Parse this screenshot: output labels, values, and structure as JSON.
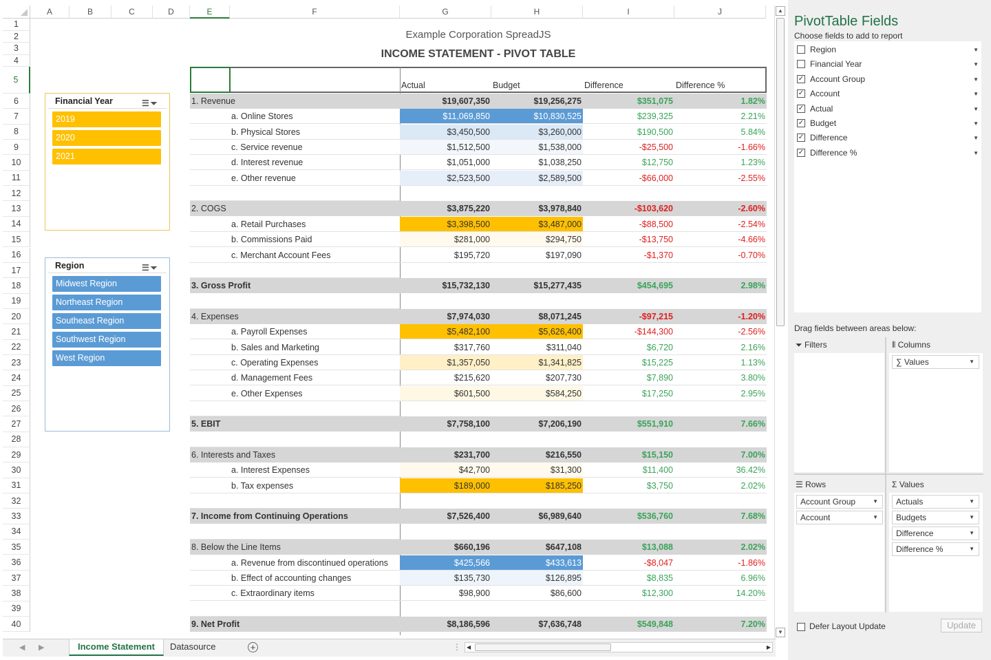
{
  "columns": [
    "A",
    "B",
    "C",
    "D",
    "E",
    "F",
    "G",
    "H",
    "I",
    "J"
  ],
  "rows": [
    "1",
    "2",
    "3",
    "4",
    "5",
    "6",
    "7",
    "8",
    "9",
    "10",
    "11",
    "12",
    "13",
    "14",
    "15",
    "16",
    "17",
    "18",
    "19",
    "20",
    "21",
    "22",
    "23",
    "24",
    "25",
    "26",
    "27",
    "28",
    "29",
    "30",
    "31",
    "32",
    "33",
    "34",
    "35",
    "36",
    "37",
    "38",
    "39",
    "40"
  ],
  "company": "Example Corporation SpreadJS",
  "report_title": "INCOME STATEMENT - PIVOT TABLE",
  "headers": {
    "actual": "Actual",
    "budget": "Budget",
    "difference": "Difference",
    "difference_pct": "Difference %"
  },
  "pivot_rows": [
    {
      "type": "grp",
      "label": "1. Revenue",
      "actual": "$19,607,350",
      "budget": "$19,256,275",
      "diff": "$351,075",
      "pct": "1.82%",
      "sign": "pos"
    },
    {
      "type": "sub",
      "label": "a. Online Stores",
      "actual": "$11,069,850",
      "budget": "$10,830,525",
      "diff": "$239,325",
      "pct": "2.21%",
      "sign": "pos",
      "fill": "#5b9bd5"
    },
    {
      "type": "sub",
      "label": "b. Physical Stores",
      "actual": "$3,450,500",
      "budget": "$3,260,000",
      "diff": "$190,500",
      "pct": "5.84%",
      "sign": "pos",
      "fill": "#dbe8f6"
    },
    {
      "type": "sub",
      "label": "c. Service revenue",
      "actual": "$1,512,500",
      "budget": "$1,538,000",
      "diff": "-$25,500",
      "pct": "-1.66%",
      "sign": "neg",
      "fill": "#f3f7fc"
    },
    {
      "type": "sub",
      "label": "d. Interest revenue",
      "actual": "$1,051,000",
      "budget": "$1,038,250",
      "diff": "$12,750",
      "pct": "1.23%",
      "sign": "pos"
    },
    {
      "type": "sub",
      "label": "e. Other revenue",
      "actual": "$2,523,500",
      "budget": "$2,589,500",
      "diff": "-$66,000",
      "pct": "-2.55%",
      "sign": "neg",
      "fill": "#e6eff9"
    },
    {
      "type": "blank"
    },
    {
      "type": "grp",
      "label": "2. COGS",
      "actual": "$3,875,220",
      "budget": "$3,978,840",
      "diff": "-$103,620",
      "pct": "-2.60%",
      "sign": "neg"
    },
    {
      "type": "sub",
      "label": "a. Retail Purchases",
      "actual": "$3,398,500",
      "budget": "$3,487,000",
      "diff": "-$88,500",
      "pct": "-2.54%",
      "sign": "neg",
      "fill": "#ffc000"
    },
    {
      "type": "sub",
      "label": "b. Commissions Paid",
      "actual": "$281,000",
      "budget": "$294,750",
      "diff": "-$13,750",
      "pct": "-4.66%",
      "sign": "neg",
      "fill": "#fffaed"
    },
    {
      "type": "sub",
      "label": "c. Merchant Account Fees",
      "actual": "$195,720",
      "budget": "$197,090",
      "diff": "-$1,370",
      "pct": "-0.70%",
      "sign": "neg"
    },
    {
      "type": "blank"
    },
    {
      "type": "tot",
      "label": "3. Gross Profit",
      "actual": "$15,732,130",
      "budget": "$15,277,435",
      "diff": "$454,695",
      "pct": "2.98%",
      "sign": "pos"
    },
    {
      "type": "blank"
    },
    {
      "type": "grp",
      "label": "4. Expenses",
      "actual": "$7,974,030",
      "budget": "$8,071,245",
      "diff": "-$97,215",
      "pct": "-1.20%",
      "sign": "neg"
    },
    {
      "type": "sub",
      "label": "a. Payroll Expenses",
      "actual": "$5,482,100",
      "budget": "$5,626,400",
      "diff": "-$144,300",
      "pct": "-2.56%",
      "sign": "neg",
      "fill": "#ffc000"
    },
    {
      "type": "sub",
      "label": "b. Sales and Marketing",
      "actual": "$317,760",
      "budget": "$311,040",
      "diff": "$6,720",
      "pct": "2.16%",
      "sign": "pos"
    },
    {
      "type": "sub",
      "label": "c. Operating Expenses",
      "actual": "$1,357,050",
      "budget": "$1,341,825",
      "diff": "$15,225",
      "pct": "1.13%",
      "sign": "pos",
      "fill": "#fff0c8"
    },
    {
      "type": "sub",
      "label": "d. Management Fees",
      "actual": "$215,620",
      "budget": "$207,730",
      "diff": "$7,890",
      "pct": "3.80%",
      "sign": "pos"
    },
    {
      "type": "sub",
      "label": "e. Other Expenses",
      "actual": "$601,500",
      "budget": "$584,250",
      "diff": "$17,250",
      "pct": "2.95%",
      "sign": "pos",
      "fill": "#fff8e5"
    },
    {
      "type": "blank"
    },
    {
      "type": "tot",
      "label": "5. EBIT",
      "actual": "$7,758,100",
      "budget": "$7,206,190",
      "diff": "$551,910",
      "pct": "7.66%",
      "sign": "pos"
    },
    {
      "type": "blank"
    },
    {
      "type": "grp",
      "label": "6. Interests and Taxes",
      "actual": "$231,700",
      "budget": "$216,550",
      "diff": "$15,150",
      "pct": "7.00%",
      "sign": "pos"
    },
    {
      "type": "sub",
      "label": "a. Interest Expenses",
      "actual": "$42,700",
      "budget": "$31,300",
      "diff": "$11,400",
      "pct": "36.42%",
      "sign": "pos",
      "fill": "#fffaed"
    },
    {
      "type": "sub",
      "label": "b. Tax expenses",
      "actual": "$189,000",
      "budget": "$185,250",
      "diff": "$3,750",
      "pct": "2.02%",
      "sign": "pos",
      "fill": "#ffc000"
    },
    {
      "type": "blank"
    },
    {
      "type": "tot",
      "label": "7. Income from Continuing Operations",
      "actual": "$7,526,400",
      "budget": "$6,989,640",
      "diff": "$536,760",
      "pct": "7.68%",
      "sign": "pos"
    },
    {
      "type": "blank"
    },
    {
      "type": "grp",
      "label": "8. Below the Line Items",
      "actual": "$660,196",
      "budget": "$647,108",
      "diff": "$13,088",
      "pct": "2.02%",
      "sign": "pos"
    },
    {
      "type": "sub",
      "label": "a. Revenue from discontinued operations",
      "actual": "$425,566",
      "budget": "$433,613",
      "diff": "-$8,047",
      "pct": "-1.86%",
      "sign": "neg",
      "fill": "#5b9bd5"
    },
    {
      "type": "sub",
      "label": "b. Effect of accounting changes",
      "actual": "$135,730",
      "budget": "$126,895",
      "diff": "$8,835",
      "pct": "6.96%",
      "sign": "pos",
      "fill": "#eef4fb"
    },
    {
      "type": "sub",
      "label": "c. Extraordinary items",
      "actual": "$98,900",
      "budget": "$86,600",
      "diff": "$12,300",
      "pct": "14.20%",
      "sign": "pos"
    },
    {
      "type": "blank"
    },
    {
      "type": "tot",
      "label": "9. Net Profit",
      "actual": "$8,186,596",
      "budget": "$7,636,748",
      "diff": "$549,848",
      "pct": "7.20%",
      "sign": "pos"
    }
  ],
  "slicer_year": {
    "title": "Financial Year",
    "items": [
      "2019",
      "2020",
      "2021"
    ]
  },
  "slicer_region": {
    "title": "Region",
    "items": [
      "Midwest Region",
      "Northeast Region",
      "Southeast Region",
      "Southwest Region",
      "West Region"
    ]
  },
  "tabs": {
    "active": "Income Statement",
    "other": "Datasource"
  },
  "panel": {
    "title": "PivotTable Fields",
    "subtitle": "Choose fields to add to report",
    "fields": [
      {
        "label": "Region",
        "checked": false
      },
      {
        "label": "Financial Year",
        "checked": false
      },
      {
        "label": "Account Group",
        "checked": true
      },
      {
        "label": "Account",
        "checked": true
      },
      {
        "label": "Actual",
        "checked": true
      },
      {
        "label": "Budget",
        "checked": true
      },
      {
        "label": "Difference",
        "checked": true
      },
      {
        "label": "Difference %",
        "checked": true
      }
    ],
    "drag_text": "Drag fields between areas below:",
    "filters": "Filters",
    "columns": "Columns",
    "rows_label": "Rows",
    "values_label": "Values",
    "columns_items": [
      "∑ Values"
    ],
    "rows_items": [
      "Account Group",
      "Account"
    ],
    "values_items": [
      "Actuals",
      "Budgets",
      "Difference",
      "Difference %"
    ],
    "defer": "Defer Layout Update",
    "update": "Update"
  },
  "colors": {
    "accent_green": "#217346",
    "positive": "#3aa35a",
    "negative": "#e02020",
    "gold": "#ffc000",
    "blue": "#5b9bd5"
  }
}
